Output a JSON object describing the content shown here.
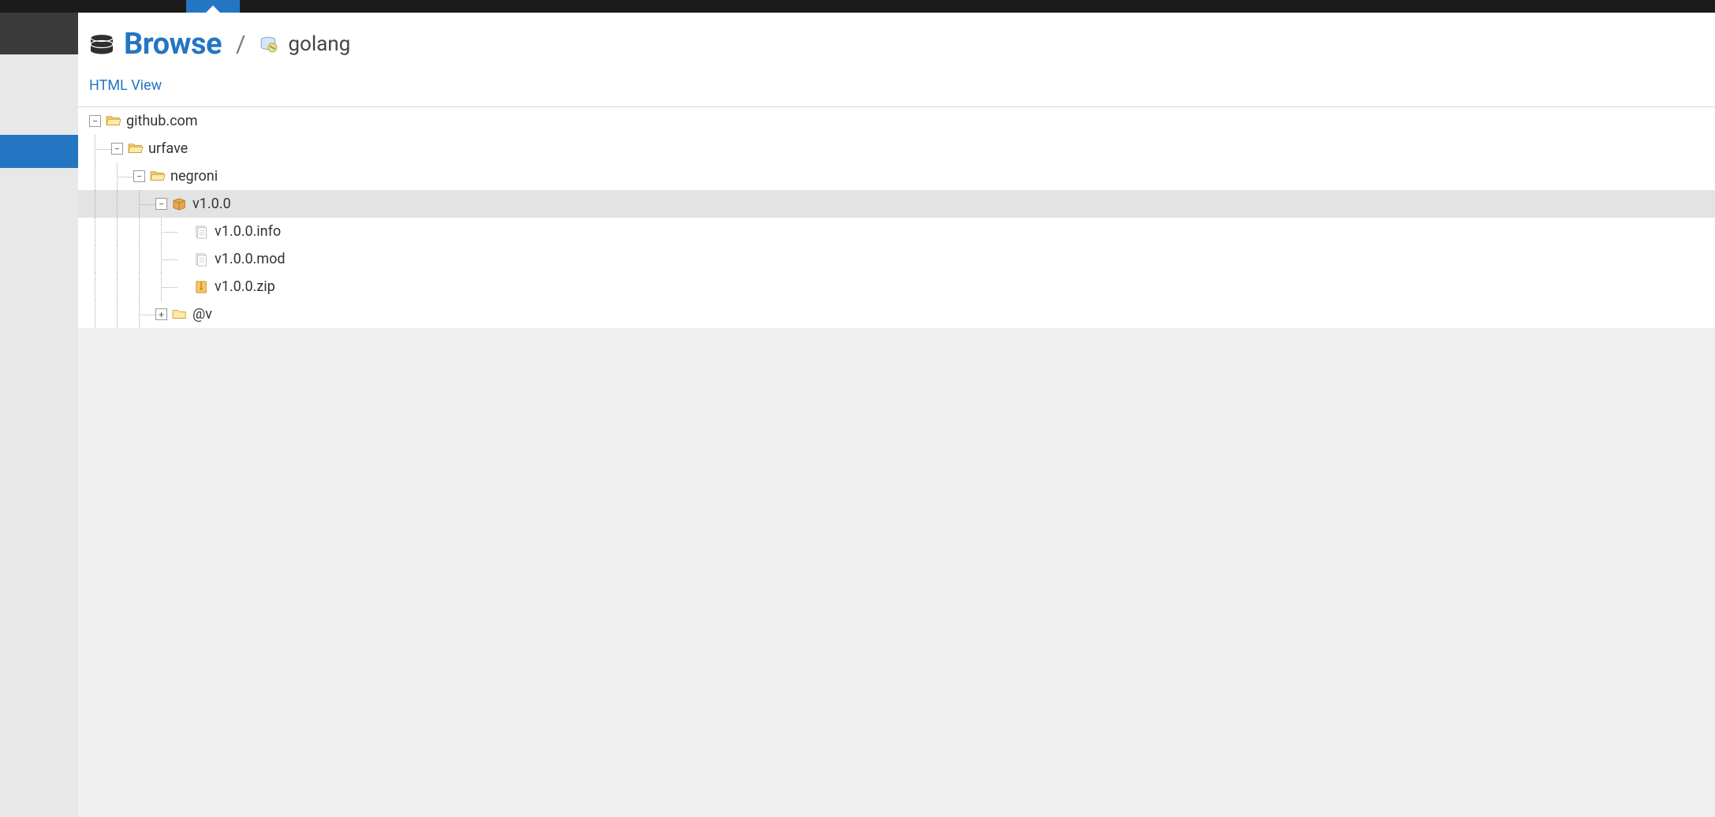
{
  "header": {
    "title": "Browse",
    "separator": "/",
    "repo_name": "golang"
  },
  "subheader": {
    "html_view_label": "HTML View"
  },
  "tree": {
    "nodes": [
      {
        "id": "github",
        "depth": 0,
        "toggle": "minus",
        "icon": "folder-open",
        "label": "github.com",
        "selected": false
      },
      {
        "id": "urfave",
        "depth": 1,
        "toggle": "minus",
        "icon": "folder-open",
        "label": "urfave",
        "selected": false
      },
      {
        "id": "negroni",
        "depth": 2,
        "toggle": "minus",
        "icon": "folder-open",
        "label": "negroni",
        "selected": false
      },
      {
        "id": "v100",
        "depth": 3,
        "toggle": "minus",
        "icon": "package",
        "label": "v1.0.0",
        "selected": true
      },
      {
        "id": "v100info",
        "depth": 4,
        "toggle": "none",
        "icon": "file",
        "label": "v1.0.0.info",
        "selected": false
      },
      {
        "id": "v100mod",
        "depth": 4,
        "toggle": "none",
        "icon": "file",
        "label": "v1.0.0.mod",
        "selected": false
      },
      {
        "id": "v100zip",
        "depth": 4,
        "toggle": "none",
        "icon": "archive",
        "label": "v1.0.0.zip",
        "selected": false
      },
      {
        "id": "atv",
        "depth": 3,
        "toggle": "plus",
        "icon": "folder",
        "label": "@v",
        "selected": false
      }
    ]
  }
}
